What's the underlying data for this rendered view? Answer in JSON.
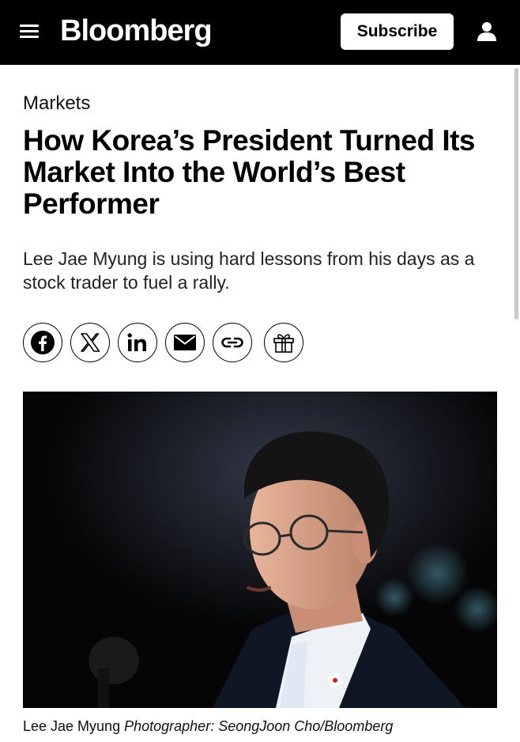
{
  "header": {
    "logo": "Bloomberg",
    "subscribe_label": "Subscribe"
  },
  "article": {
    "section": "Markets",
    "headline": "How Korea’s President Turned Its Market Into the World’s Best Performer",
    "dek": "Lee Jae Myung is using hard lessons from his days as a stock trader to fuel a rally.",
    "share_icons": [
      "facebook-icon",
      "x-icon",
      "linkedin-icon",
      "email-icon",
      "link-icon",
      "gift-icon"
    ],
    "image_caption": "Lee Jae Myung",
    "image_credit": "Photographer: SeongJoon Cho/Bloomberg"
  },
  "colors": {
    "header_bg": "#000000",
    "page_bg": "#ffffff",
    "text": "#000000"
  }
}
